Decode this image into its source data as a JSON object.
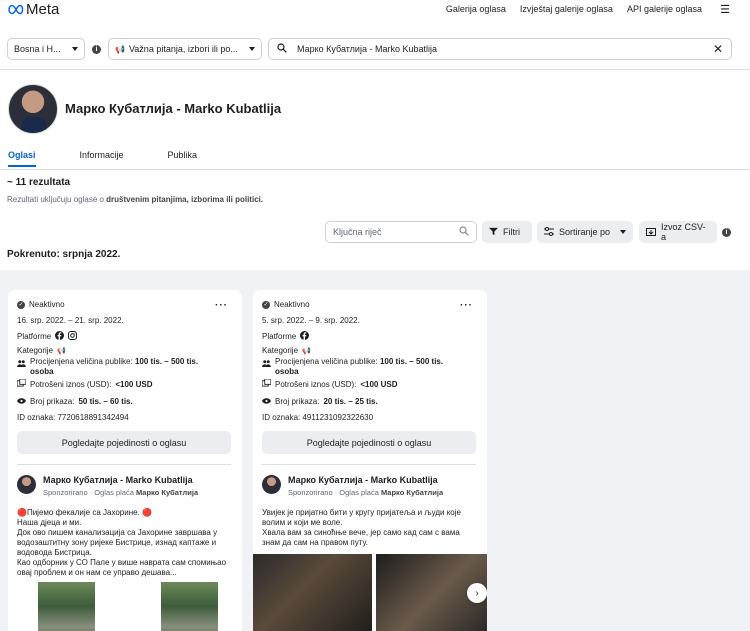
{
  "header": {
    "logo_text": "Meta",
    "nav": [
      "Galerija oglasa",
      "Izvještaj galerije oglasa",
      "API galerije oglasa"
    ]
  },
  "filters": {
    "country": "Bosna i H...",
    "category": "Važna pitanja, izbori ili po...",
    "search_value": "Марко Кубатлија - Marko Kubatlija"
  },
  "profile": {
    "name": "Марко Кубатлија - Marko Kubatlija"
  },
  "tabs": [
    "Oglasi",
    "Informacije",
    "Publika"
  ],
  "results": {
    "count": "~ 11 rezultata",
    "note_prefix": "Rezultati uključuju oglase o ",
    "note_bold": "društvenim pitanjima, izborima ili politici."
  },
  "toolbar": {
    "keyword_placeholder": "Ključna riječ",
    "filters_label": "Filtri",
    "sort_label": "Sortiranje po",
    "export_label": "Izvoz CSV-a"
  },
  "launched": "Pokrenuto: srpnja 2022.",
  "cards": [
    {
      "status": "Neaktivno",
      "dates": "16. srp. 2022. – 21. srp. 2022.",
      "platforms_label": "Platforme",
      "category_label": "Kategorije",
      "audience_label": "Procijenjena veličina publike: ",
      "audience_value": "100 tis. – 500 tis.",
      "audience_unit": "osoba",
      "spend_label": "Potrošeni iznos (USD): ",
      "spend_value": "<100 USD",
      "impressions_label": "Broj prikaza: ",
      "impressions_value": "50 tis. – 60 tis.",
      "id_label": "ID oznaka: 7720618891342494",
      "details_label": "Pogledajte pojedinosti o oglasu",
      "advertiser": "Марко Кубатлија - Marko Kubatlija",
      "sponsored": "Sponzorirano · Oglas plaća ",
      "payer": "Марко Кубатлија",
      "text": [
        "🔴Пијемо фекалије са Јахорине. 🔴",
        "Наша дјеца и ми.",
        "Док ово пишем канализација са Јахорине завршава у водозаштитну зону ријеке Бистрице, изнад каптаже и водовода Бистрица.",
        "Као одборник у СО Пале у више наврата сам спомињао овај проблем и он нам се управо дешава..."
      ]
    },
    {
      "status": "Neaktivno",
      "dates": "5. srp. 2022. – 9. srp. 2022.",
      "platforms_label": "Platforme",
      "category_label": "Kategorije",
      "audience_label": "Procijenjena veličina publike: ",
      "audience_value": "100 tis. – 500 tis.",
      "audience_unit": "osoba",
      "spend_label": "Potrošeni iznos (USD): ",
      "spend_value": "<100 USD",
      "impressions_label": "Broj prikaza: ",
      "impressions_value": "20 tis. – 25 tis.",
      "id_label": "ID oznaka: 4911231092322630",
      "details_label": "Pogledajte pojedinosti o oglasu",
      "advertiser": "Марко Кубатлија - Marko Kubatlija",
      "sponsored": "Sponzorirano · Oglas plaća ",
      "payer": "Марко Кубатлија",
      "text": [
        "Увијек је пријатно бити у кругу пријатеља и људи које волим и који ме воле.",
        "Хвала вам за синоћње вече, јер само кад сам с вама знам да сам на правом путу."
      ]
    }
  ]
}
